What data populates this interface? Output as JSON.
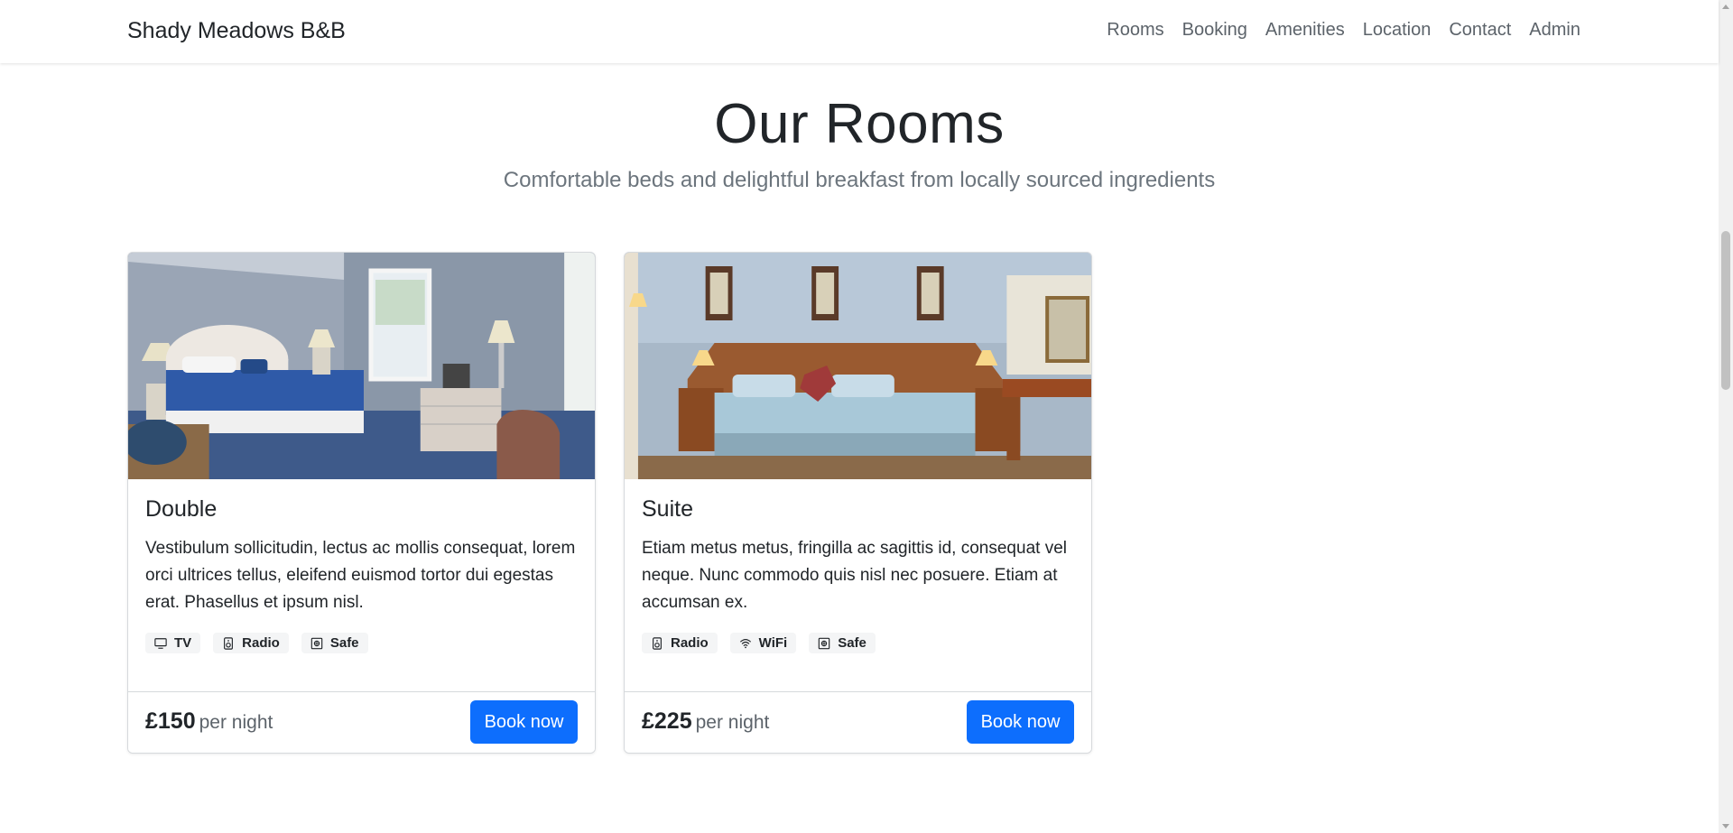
{
  "navbar": {
    "brand": "Shady Meadows B&B",
    "links": [
      "Rooms",
      "Booking",
      "Amenities",
      "Location",
      "Contact",
      "Admin"
    ]
  },
  "section": {
    "title": "Our Rooms",
    "subtitle": "Comfortable beds and delightful breakfast from locally sourced ingredients"
  },
  "rooms": [
    {
      "name": "Double",
      "description": "Vestibulum sollicitudin, lectus ac mollis consequat, lorem orci ultrices tellus, eleifend euismod tortor dui egestas erat. Phasellus et ipsum nisl.",
      "features": [
        {
          "label": "TV",
          "icon": "tv-icon"
        },
        {
          "label": "Radio",
          "icon": "radio-icon"
        },
        {
          "label": "Safe",
          "icon": "safe-icon"
        }
      ],
      "price": "£150",
      "price_unit": "per night",
      "book_label": "Book now"
    },
    {
      "name": "Suite",
      "description": "Etiam metus metus, fringilla ac sagittis id, consequat vel neque. Nunc commodo quis nisl nec posuere. Etiam at accumsan ex.",
      "features": [
        {
          "label": "Radio",
          "icon": "radio-icon"
        },
        {
          "label": "WiFi",
          "icon": "wifi-icon"
        },
        {
          "label": "Safe",
          "icon": "safe-icon"
        }
      ],
      "price": "£225",
      "price_unit": "per night",
      "book_label": "Book now"
    }
  ],
  "colors": {
    "primary": "#0d6efd",
    "text": "#212529",
    "muted": "#6c757d"
  }
}
